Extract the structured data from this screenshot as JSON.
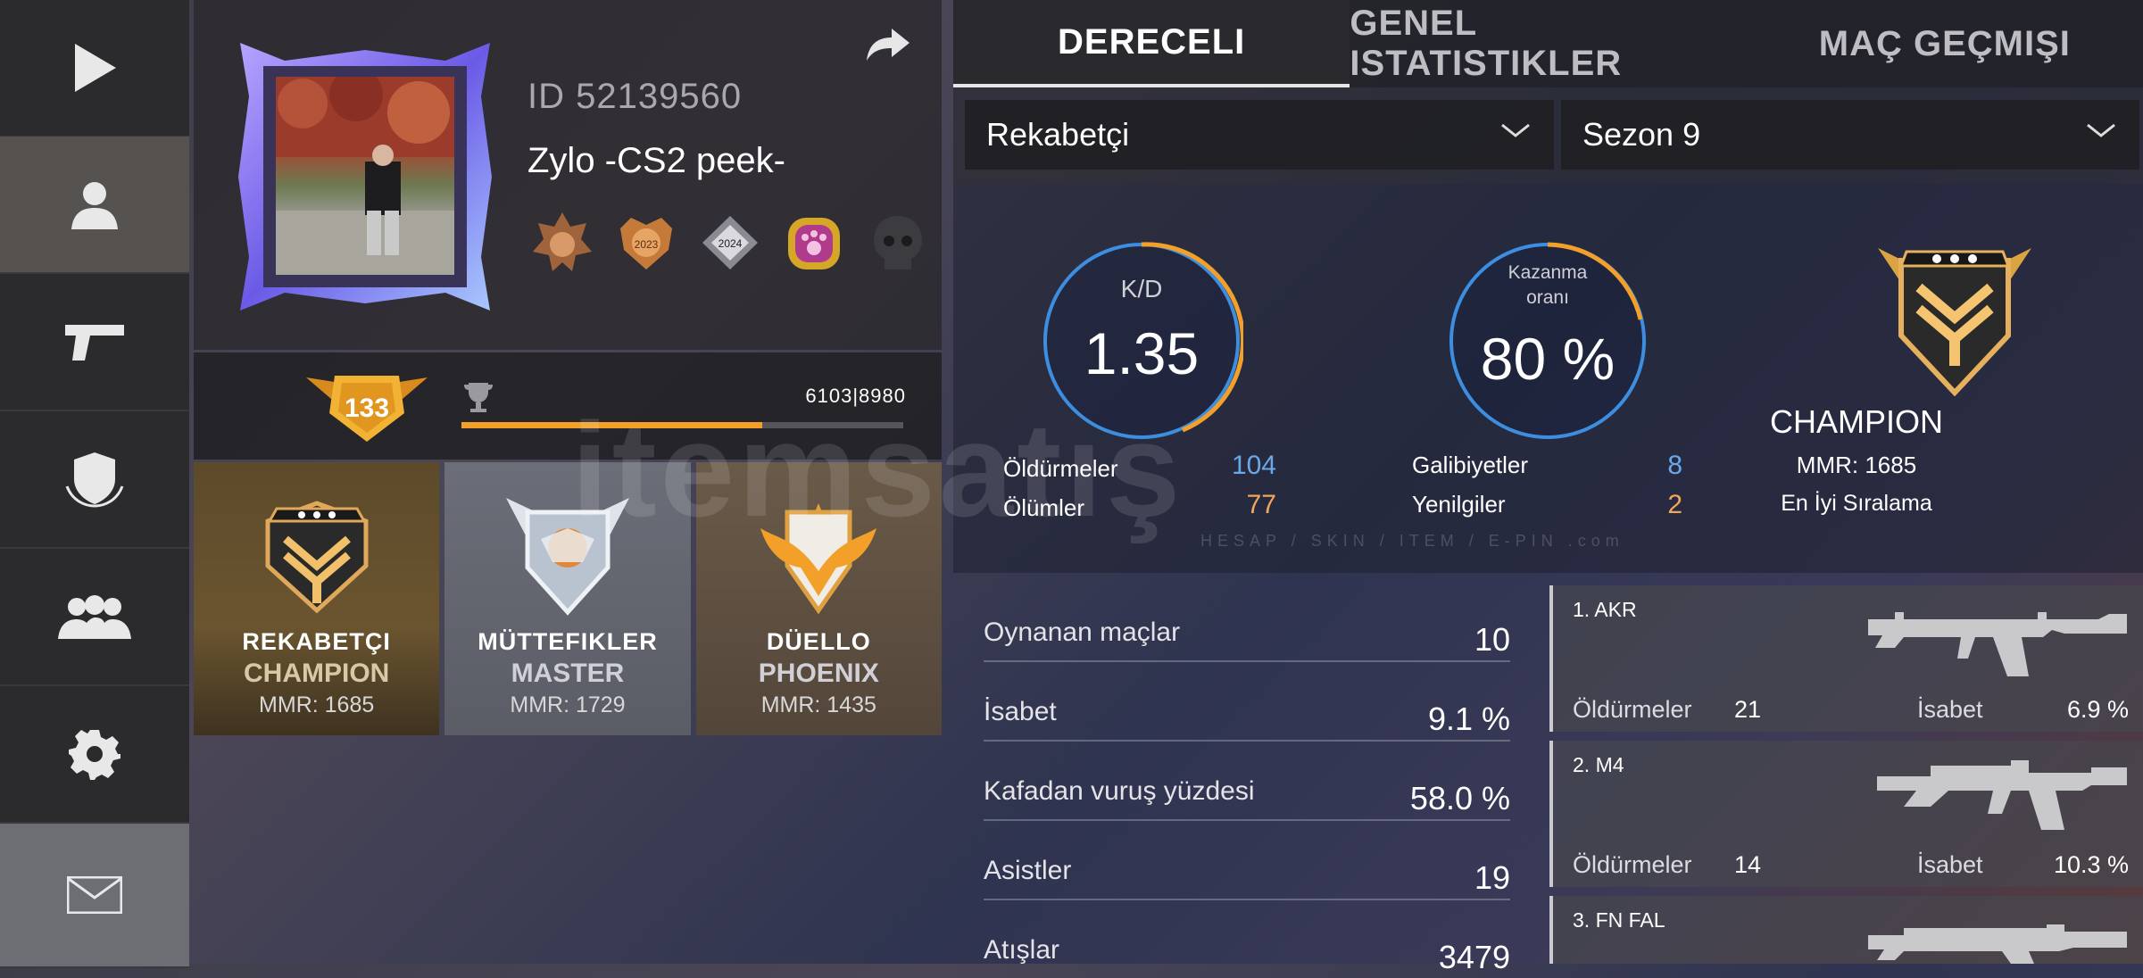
{
  "nav": {
    "items": [
      {
        "icon": "play-icon"
      },
      {
        "icon": "profile-icon",
        "active": true
      },
      {
        "icon": "pistol-icon"
      },
      {
        "icon": "shield-icon"
      },
      {
        "icon": "friends-icon"
      },
      {
        "icon": "gear-icon"
      },
      {
        "icon": "mail-icon"
      }
    ]
  },
  "profile": {
    "id_text": "ID 52139560",
    "name": "Zylo -CS2 peek-",
    "badges": [
      {
        "icon": "bronze-medal-icon"
      },
      {
        "icon": "2023-medal-icon",
        "text": "2023"
      },
      {
        "icon": "2024-medal-icon",
        "text": "2024"
      },
      {
        "icon": "paw-badge-icon"
      },
      {
        "icon": "dark-skull-badge-icon"
      }
    ],
    "level": "133",
    "xp_text": "6103|8980",
    "xp_progress": 0.68
  },
  "rank_cards": [
    {
      "mode": "REKABETÇI",
      "tier": "CHAMPION",
      "mmr": "MMR: 1685"
    },
    {
      "mode": "MÜTTEFIKLER",
      "tier": "MASTER",
      "mmr": "MMR: 1729"
    },
    {
      "mode": "DÜELLO",
      "tier": "PHOENIX",
      "mmr": "MMR: 1435"
    }
  ],
  "tabs": [
    {
      "label": "DERECELI",
      "active": true
    },
    {
      "label": "GENEL ISTATISTIKLER",
      "active": false
    },
    {
      "label": "MAÇ GEÇMIŞI",
      "active": false
    }
  ],
  "filters": {
    "mode": "Rekabetçi",
    "season": "Sezon 9"
  },
  "summary": {
    "kd_label": "K/D",
    "kd_value": "1.35",
    "winrate_label_1": "Kazanma",
    "winrate_label_2": "oranı",
    "winrate_value": "80 %",
    "kills_label": "Öldürmeler",
    "kills_value": "104",
    "deaths_label": "Ölümler",
    "deaths_value": "77",
    "wins_label": "Galibiyetler",
    "wins_value": "8",
    "losses_label": "Yenilgiler",
    "losses_value": "2",
    "rank_title": "CHAMPION",
    "rank_mmr": "MMR: 1685",
    "rank_best": "En İyi Sıralama"
  },
  "details": [
    {
      "label": "Oynanan maçlar",
      "value": "10"
    },
    {
      "label": "İsabet",
      "value": "9.1 %"
    },
    {
      "label": "Kafadan vuruş yüzdesi",
      "value": "58.0 %"
    },
    {
      "label": "Asistler",
      "value": "19"
    },
    {
      "label": "Atışlar",
      "value": "3479"
    }
  ],
  "weapons": [
    {
      "name": "1. AKR",
      "kills_label": "Öldürmeler",
      "kills": "21",
      "acc_label": "İsabet",
      "acc": "6.9 %"
    },
    {
      "name": "2. M4",
      "kills_label": "Öldürmeler",
      "kills": "14",
      "acc_label": "İsabet",
      "acc": "10.3 %"
    },
    {
      "name": "3. FN FAL",
      "kills_label": "",
      "kills": "",
      "acc_label": "",
      "acc": ""
    }
  ],
  "watermark": {
    "main": "itemsatış",
    "sub": "HESAP / SKIN / ITEM / E-PIN .com"
  },
  "colors": {
    "accent_orange": "#f2a02a",
    "accent_blue": "#6aa9e6",
    "gold": "#d9a441"
  }
}
